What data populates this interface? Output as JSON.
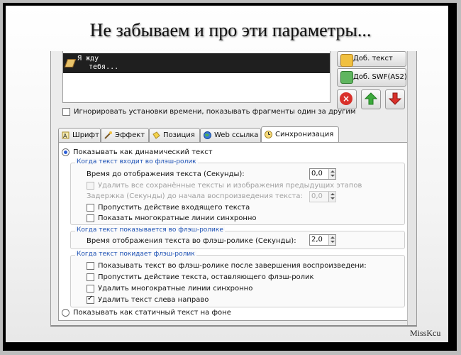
{
  "headline": "Не забываем и про эти параметры...",
  "signature": "MissKcu",
  "text_list": {
    "line1": "Я жду",
    "line2": "тебя..."
  },
  "side_buttons": {
    "add_text": "Доб. текст",
    "add_swf": "Доб. SWF(AS2)",
    "delete_symbol": "×"
  },
  "ignore_timing": "Игнорировать установки времени, показывать фрагменты один за другим",
  "tabs": [
    {
      "label": "Шрифт",
      "icon": "font-icon"
    },
    {
      "label": "Эффект",
      "icon": "effect-icon"
    },
    {
      "label": "Позиция",
      "icon": "position-icon"
    },
    {
      "label": "Web ссылка",
      "icon": "globe-icon"
    },
    {
      "label": "Синхронизация",
      "icon": "clock-icon",
      "active": true
    }
  ],
  "sync": {
    "dynamic_radio": "Показывать как динамический текст",
    "static_radio": "Показывать как статичный текст на фоне",
    "enter": {
      "title": "Когда текст входит во флэш-ролик",
      "time_label": "Время до отображения текста (Секунды):",
      "time_value": "0,0",
      "remove_saved": "Удалить все сохранённые тексты и изображения предыдущих этапов",
      "delay_label": "Задержка (Секунды) до начала воспроизведения текста:",
      "delay_value": "0,0",
      "skip_action": "Пропустить действие входящего текста",
      "show_lines": "Показать многократные линии синхронно"
    },
    "shown": {
      "title": "Когда текст показывается во флэш-ролике",
      "time_label": "Время отображения текста во флэш-ролике (Секунды):",
      "time_value": "2,0"
    },
    "leave": {
      "title": "Когда текст покидает флэш-ролик",
      "show_after": "Показывать текст во флэш-ролике после завершения воспроизведени:",
      "skip_leaving": "Пропустить действие текста, оставляющего флэш-ролик",
      "remove_lines": "Удалить многократные линии синхронно",
      "remove_ltr": "Удалить текст слева направо"
    }
  },
  "colors": {
    "accent": "#2c5ed6",
    "group_title": "#1a4fb4",
    "delete": "#d9302a",
    "up": "#3daa3d",
    "down": "#d9302a"
  }
}
